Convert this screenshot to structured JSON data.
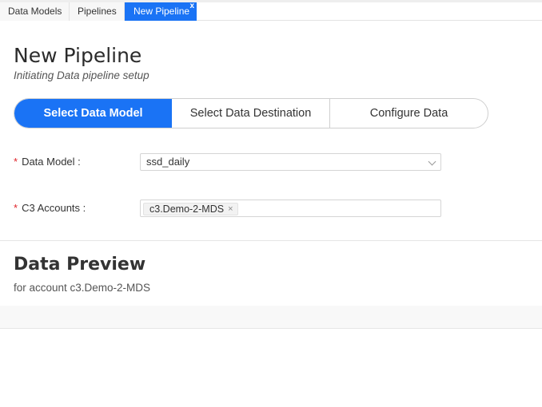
{
  "tabs": {
    "data_models": "Data Models",
    "pipelines": "Pipelines",
    "new_pipeline": "New Pipeline",
    "close_glyph": "x"
  },
  "page": {
    "title": "New Pipeline",
    "subtitle": "Initiating Data pipeline setup"
  },
  "steps": [
    {
      "label": "Select Data Model",
      "active": true
    },
    {
      "label": "Select Data Destination",
      "active": false
    },
    {
      "label": "Configure Data",
      "active": false
    }
  ],
  "form": {
    "required_mark": "*",
    "data_model": {
      "label": "Data Model :",
      "value": "ssd_daily"
    },
    "c3_accounts": {
      "label": "C3 Accounts :",
      "chips": [
        "c3.Demo-2-MDS"
      ],
      "chip_remove": "×"
    }
  },
  "preview": {
    "title": "Data Preview",
    "subtitle": "for account c3.Demo-2-MDS"
  },
  "colors": {
    "primary": "#1a73f5",
    "required": "#e0242a"
  }
}
